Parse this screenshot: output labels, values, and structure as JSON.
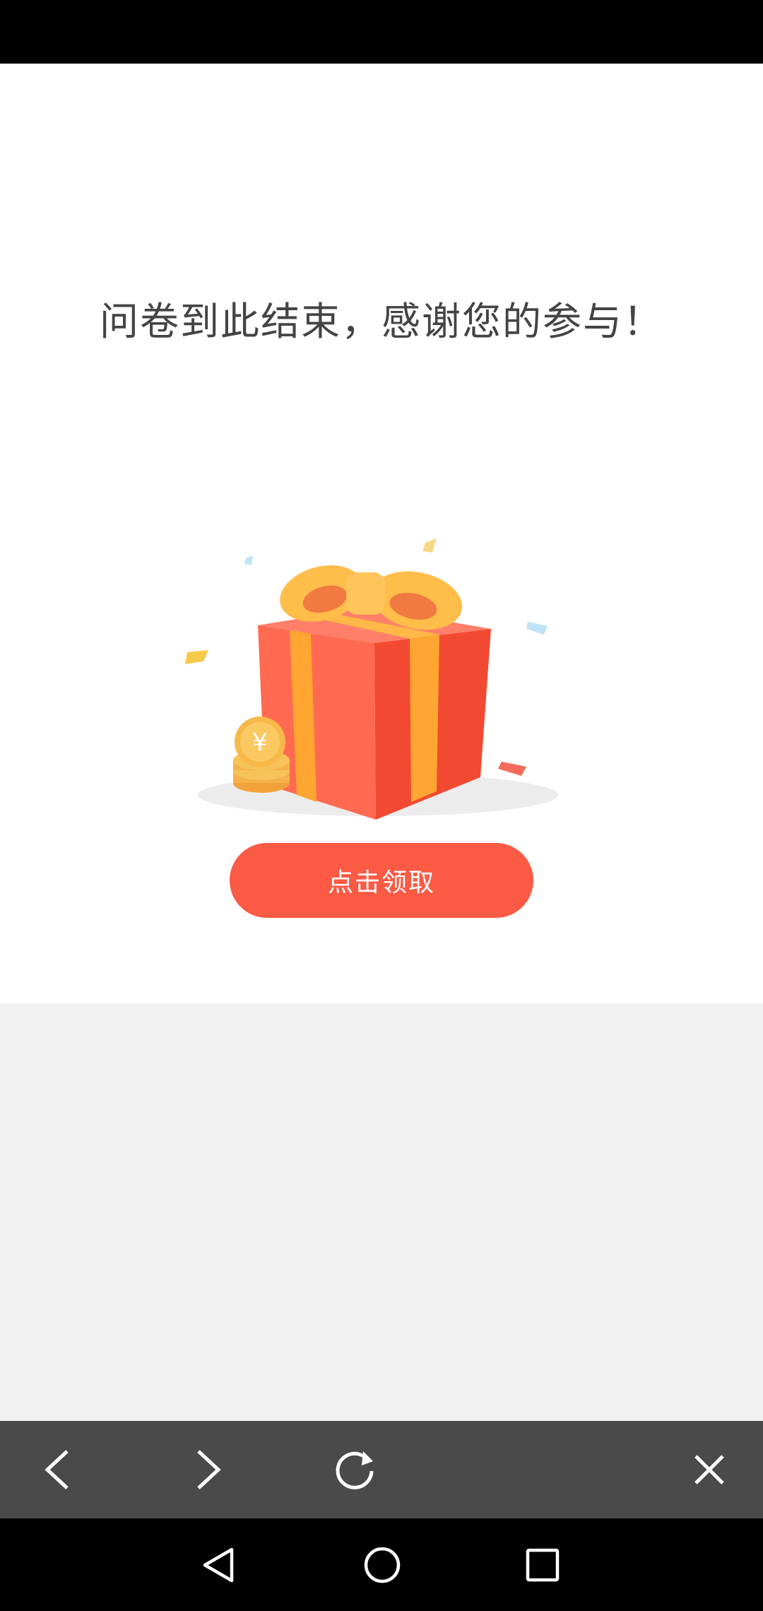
{
  "survey": {
    "end_message": "问卷到此结束，感谢您的参与！",
    "claim_button_label": "点击领取",
    "gift_coin_symbol": "¥"
  },
  "browser_toolbar": {
    "icons": [
      "back-icon",
      "forward-icon",
      "refresh-icon",
      "close-icon"
    ]
  },
  "system_nav": {
    "icons": [
      "nav-back-icon",
      "nav-home-icon",
      "nav-recents-icon"
    ]
  },
  "colors": {
    "accent": "#fb5a45",
    "toolbar": "#4a4a4a",
    "background": "#ffffff",
    "blank_area": "#f0f0f0"
  }
}
